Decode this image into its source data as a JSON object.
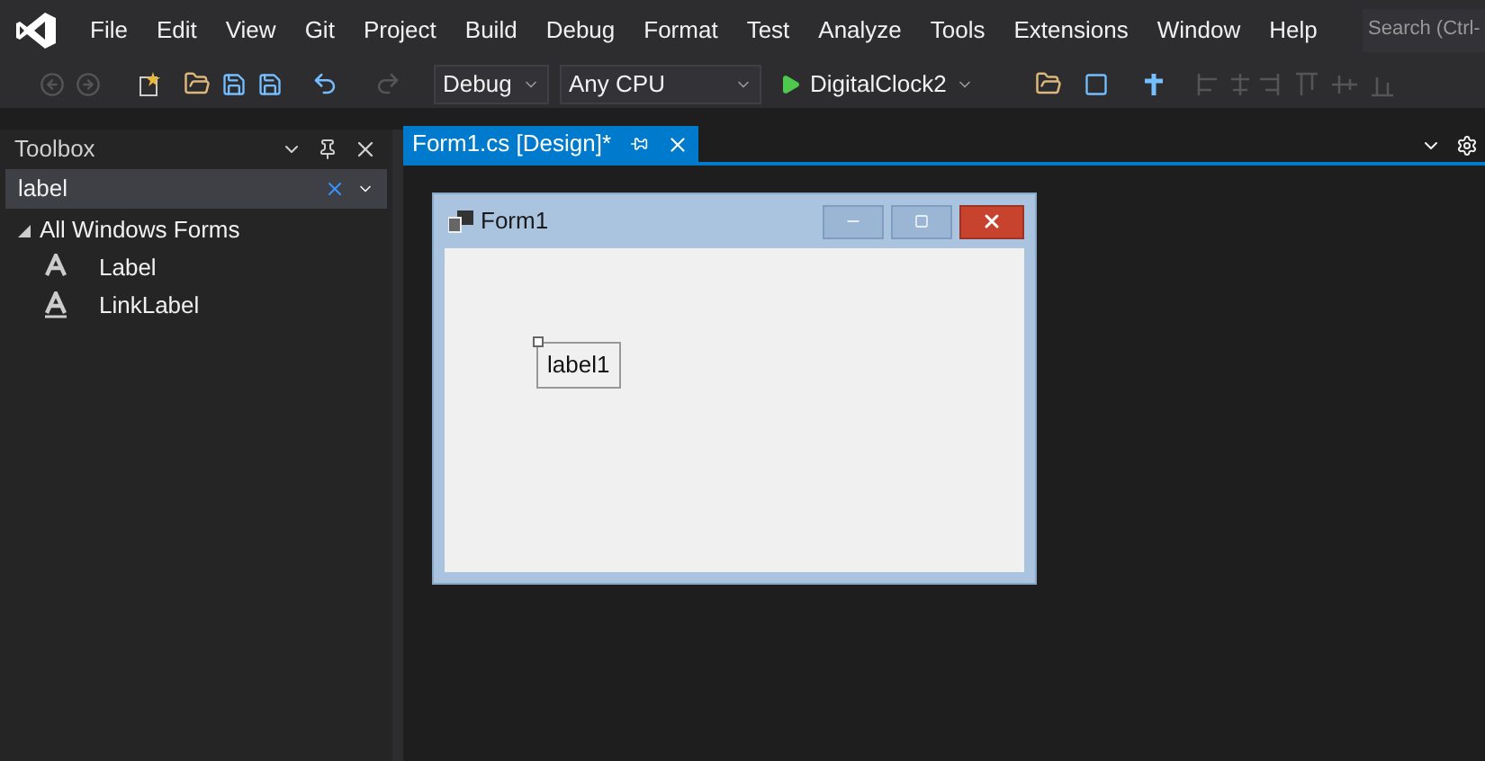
{
  "menu": [
    "File",
    "Edit",
    "View",
    "Git",
    "Project",
    "Build",
    "Debug",
    "Format",
    "Test",
    "Analyze",
    "Tools",
    "Extensions",
    "Window",
    "Help"
  ],
  "search": {
    "placeholder": "Search (Ctrl-"
  },
  "toolbar": {
    "configuration": "Debug",
    "platform": "Any CPU",
    "run_target": "DigitalClock2"
  },
  "toolbox": {
    "title": "Toolbox",
    "search_value": "label",
    "groups": [
      {
        "label": "All Windows Forms",
        "expanded": true,
        "children": [
          {
            "label": "Label",
            "kind": "label"
          },
          {
            "label": "LinkLabel",
            "kind": "linklabel"
          }
        ]
      }
    ]
  },
  "tabs": [
    {
      "label": "Form1.cs [Design]*",
      "selected": true
    }
  ],
  "form": {
    "title": "Form1",
    "controls": [
      {
        "text": "label1",
        "selected": true
      }
    ]
  }
}
